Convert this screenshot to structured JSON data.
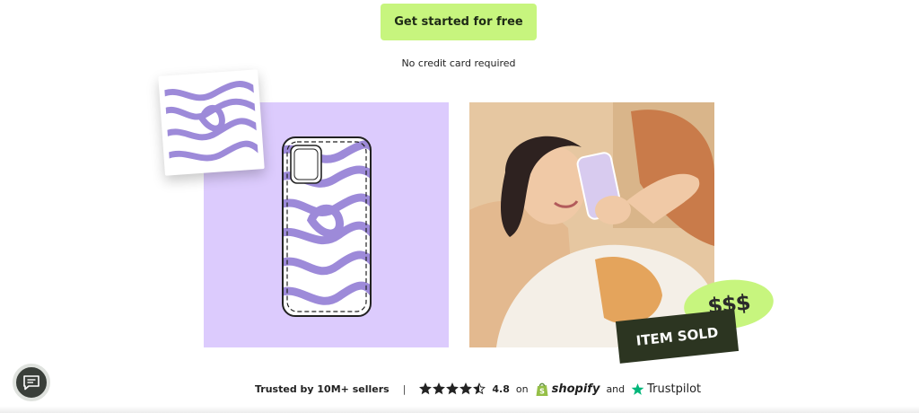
{
  "hero": {
    "cta_label": "Get started for free",
    "subtext": "No credit card required"
  },
  "showcase": {
    "sticker_money": "$$$",
    "sticker_sold": "ITEM SOLD"
  },
  "trust": {
    "sellers": "Trusted by 10M+ sellers",
    "separator": "|",
    "rating": "4.8",
    "stars": 4.5,
    "on": "on",
    "shopify": "shopify",
    "and": "and",
    "trustpilot": "Trustpilot"
  },
  "colors": {
    "accent": "#c7f57e",
    "lavender": "#dccbfd",
    "swirl": "#9d8ad9",
    "dark_green": "#2c3521",
    "shopify_green": "#95bf47",
    "trustpilot_green": "#00b67a"
  },
  "icons": {
    "chat": "chat-bubble-icon",
    "star": "star-icon",
    "shopify": "shopify-bag-icon",
    "trustpilot": "trustpilot-star-icon"
  }
}
